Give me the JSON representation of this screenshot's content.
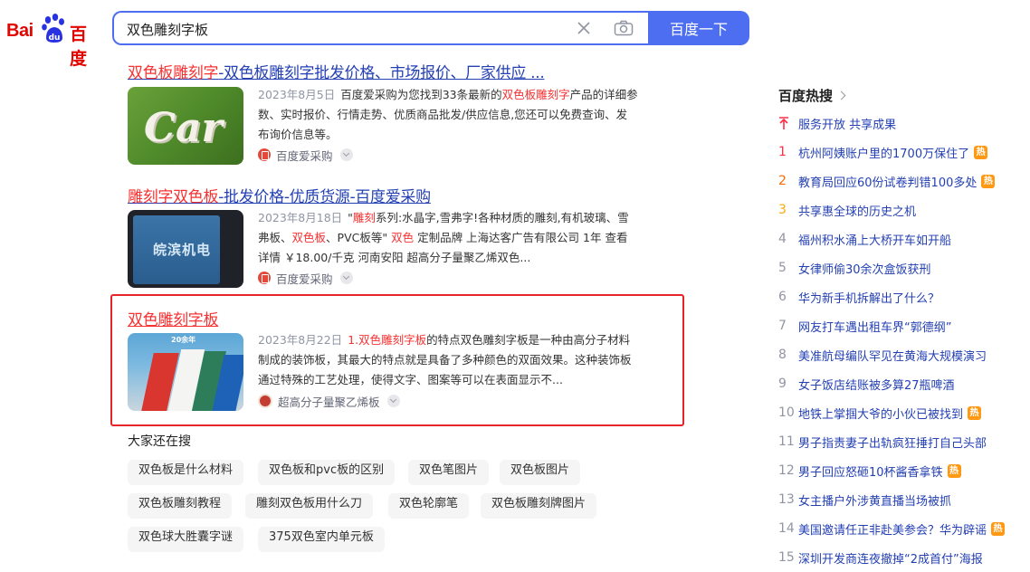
{
  "logo": {
    "bai": "Bai",
    "du": "百度"
  },
  "search": {
    "query": "双色雕刻字板",
    "button": "百度一下"
  },
  "results": [
    {
      "title_hl": "双色板雕刻字",
      "title_rest": "-双色板雕刻字批发价格、市场报价、厂家供应 ...",
      "date": "2023年8月5日",
      "body_a": "百度爱采购为您找到33条最新的",
      "body_hl": "双色板雕刻字",
      "body_b": "产品的详细参数、实时报价、行情走势、优质商品批发/供应信息,您还可以免费查询、发布询价信息等。",
      "source": "百度爱采购",
      "thumb_text": "Car"
    },
    {
      "title_hl": "雕刻字双色板",
      "title_rest": "-批发价格-优质货源-百度爱采购",
      "date": "2023年8月18日",
      "body_pre": "\"",
      "body_hl1": "雕刻",
      "body_mid1": "系列:水晶字,雪弗字!各种材质的雕刻,有机玻璃、雪弗板、",
      "body_hl2": "双色板",
      "body_mid2": "、PVC板等\" ",
      "body_hl3": "双色",
      "body_b": " 定制品牌 上海达客广告有限公司 1年 查看详情 ￥18.00/千克 河南安阳 超高分子量聚乙烯双色...",
      "source": "百度爱采购",
      "thumb_text": "皖滨机电"
    },
    {
      "title": "双色雕刻字板",
      "date": "2023年8月22日",
      "body_pre": "1.",
      "body_hl": "双色雕刻字板",
      "body_b": "的特点双色雕刻字板是一种由高分子材料制成的装饰板，其最大的特点就是具备了多种颜色的双面效果。这种装饰板通过特殊的工艺处理，使得文字、图案等可以在表面显示不...",
      "source": "超高分子量聚乙烯板",
      "thumb_text": "20余年"
    }
  ],
  "related": {
    "title": "大家还在搜",
    "items": [
      "双色板是什么材料",
      "双色板和pvc板的区别",
      "双色笔图片",
      "双色板图片",
      "双色板雕刻教程",
      "雕刻双色板用什么刀",
      "双色轮廓笔",
      "双色板雕刻牌图片",
      "双色球大胜囊字谜",
      "375双色室内单元板"
    ]
  },
  "hot": {
    "title": "百度热搜",
    "badge": "热",
    "items": [
      {
        "rank": "",
        "text": "服务开放 共享成果",
        "hot": false,
        "pinned": true
      },
      {
        "rank": "1",
        "text": "杭州阿姨账户里的1700万保住了",
        "hot": true
      },
      {
        "rank": "2",
        "text": "教育局回应60份试卷判错100多处",
        "hot": true
      },
      {
        "rank": "3",
        "text": "共享惠全球的历史之机",
        "hot": false
      },
      {
        "rank": "4",
        "text": "福州积水涌上大桥开车如开船",
        "hot": false
      },
      {
        "rank": "5",
        "text": "女律师偷30余次盒饭获刑",
        "hot": false
      },
      {
        "rank": "6",
        "text": "华为新手机拆解出了什么？",
        "hot": false
      },
      {
        "rank": "7",
        "text": "网友打车遇出租车界“郭德纲”",
        "hot": false
      },
      {
        "rank": "8",
        "text": "美准航母编队罕见在黄海大规模演习",
        "hot": false
      },
      {
        "rank": "9",
        "text": "女子饭店结账被多算27瓶啤酒",
        "hot": false
      },
      {
        "rank": "10",
        "text": "地铁上掌掴大爷的小伙已被找到",
        "hot": true
      },
      {
        "rank": "11",
        "text": "男子指责妻子出轨疯狂捶打自己头部",
        "hot": false
      },
      {
        "rank": "12",
        "text": "男子回应怒砸10杯酱香拿铁",
        "hot": true
      },
      {
        "rank": "13",
        "text": "女主播户外涉黄直播当场被抓",
        "hot": false
      },
      {
        "rank": "14",
        "text": "美国邀请任正非赴美参会？华为辟谣",
        "hot": true
      },
      {
        "rank": "15",
        "text": "深圳开发商连夜撤掉“2成首付”海报",
        "hot": false
      }
    ]
  },
  "colors": {
    "accent": "#4e6ef2",
    "link": "#2440b3",
    "highlight": "#f73131",
    "hot_badge": "#ff9812",
    "top3_rank": [
      "#fe2d46",
      "#f60",
      "#faa90e"
    ]
  }
}
